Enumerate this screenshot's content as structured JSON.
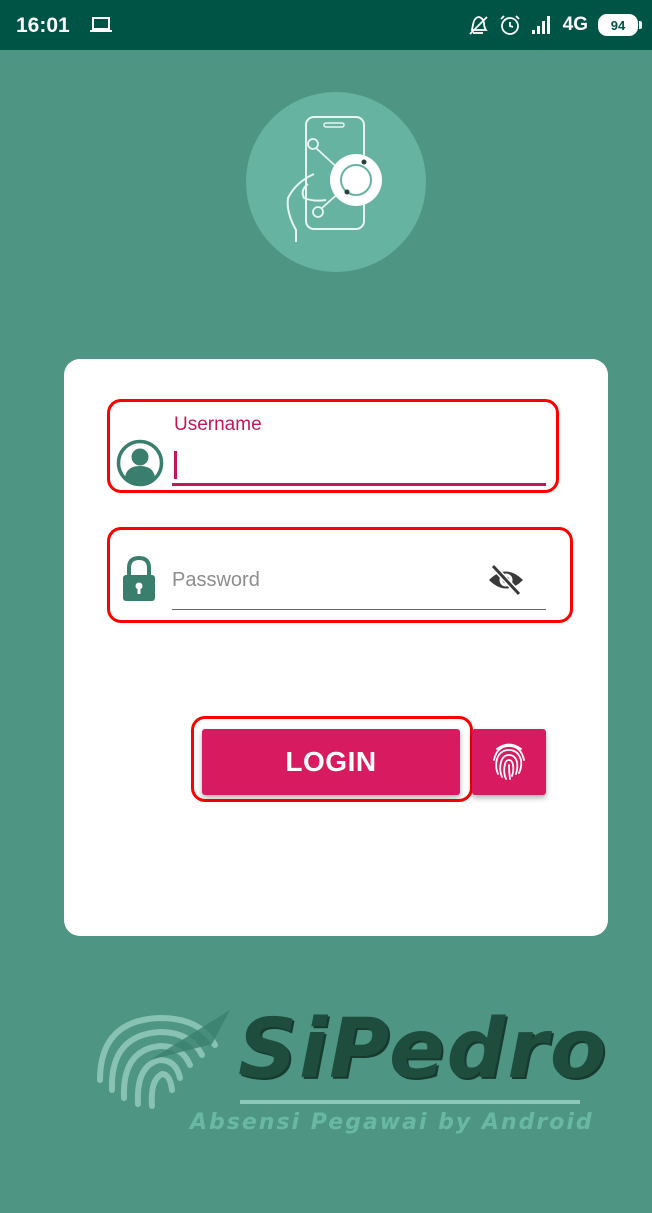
{
  "status_bar": {
    "time": "16:01",
    "network": "4G",
    "battery": "94"
  },
  "login_form": {
    "username": {
      "label": "Username",
      "value": ""
    },
    "password": {
      "placeholder": "Password",
      "value": ""
    },
    "login_label": "LOGIN"
  },
  "branding": {
    "name": "SiPedro",
    "tagline": "Absensi Pegawai by Android"
  },
  "icons": {
    "laptop": "laptop-icon",
    "mute": "bell-off-icon",
    "alarm": "alarm-icon",
    "signal": "signal-icon",
    "battery": "battery-icon",
    "app_logo": "phone-hand-icon",
    "username": "account-circle-icon",
    "password": "lock-icon",
    "visibility": "eye-off-icon",
    "fingerprint": "fingerprint-icon"
  },
  "colors": {
    "background": "#4e9583",
    "status_bar": "#005446",
    "accent": "#d81b60",
    "icon": "#3a7f6e",
    "highlight": "#ff0000"
  }
}
